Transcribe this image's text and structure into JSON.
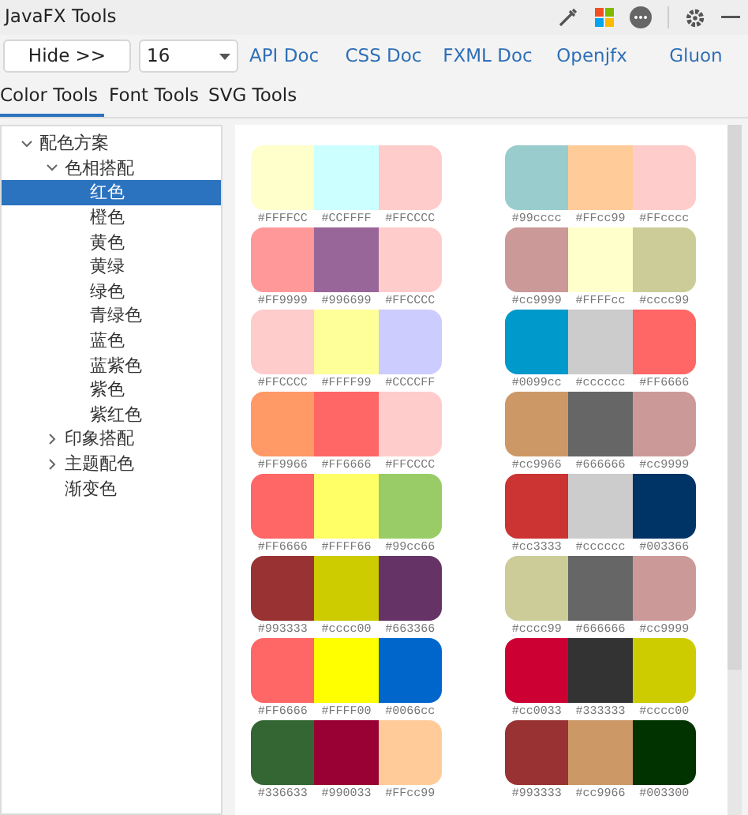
{
  "window": {
    "title": "JavaFX Tools"
  },
  "toolbar": {
    "hide_button": "Hide >>",
    "size_select": {
      "value": "16"
    },
    "links": [
      "API Doc",
      "CSS Doc",
      "FXML Doc",
      "Openjfx",
      "Gluon"
    ]
  },
  "tabs": [
    {
      "label": "Color Tools",
      "selected": true
    },
    {
      "label": "Font Tools",
      "selected": false
    },
    {
      "label": "SVG Tools",
      "selected": false
    }
  ],
  "tree": [
    {
      "label": "配色方案",
      "expanded": true,
      "selected": false,
      "children": [
        {
          "label": "色相搭配",
          "expanded": true,
          "selected": false,
          "children": [
            {
              "label": "红色",
              "selected": true
            },
            {
              "label": "橙色",
              "selected": false
            },
            {
              "label": "黄色",
              "selected": false
            },
            {
              "label": "黄绿",
              "selected": false
            },
            {
              "label": "绿色",
              "selected": false
            },
            {
              "label": "青绿色",
              "selected": false
            },
            {
              "label": "蓝色",
              "selected": false
            },
            {
              "label": "蓝紫色",
              "selected": false
            },
            {
              "label": "紫色",
              "selected": false
            },
            {
              "label": "紫红色",
              "selected": false
            }
          ]
        },
        {
          "label": "印象搭配",
          "expanded": false,
          "selected": false
        },
        {
          "label": "主题配色",
          "expanded": false,
          "selected": false
        },
        {
          "label": "渐变色",
          "selected": false
        }
      ]
    }
  ],
  "palettes": [
    {
      "swatches": [
        {
          "color": "#ffffcc",
          "label": "#FFFFCC"
        },
        {
          "color": "#ccffff",
          "label": "#CCFFFF"
        },
        {
          "color": "#ffcccc",
          "label": "#FFCCCC"
        }
      ]
    },
    {
      "swatches": [
        {
          "color": "#99cccc",
          "label": "#99cccc"
        },
        {
          "color": "#ffcc99",
          "label": "#FFcc99"
        },
        {
          "color": "#ffcccc",
          "label": "#FFcccc"
        }
      ]
    },
    {
      "swatches": [
        {
          "color": "#ff9999",
          "label": "#FF9999"
        },
        {
          "color": "#996699",
          "label": "#996699"
        },
        {
          "color": "#ffcccc",
          "label": "#FFCCCC"
        }
      ]
    },
    {
      "swatches": [
        {
          "color": "#cc9999",
          "label": "#cc9999"
        },
        {
          "color": "#ffffcc",
          "label": "#FFFFcc"
        },
        {
          "color": "#cccc99",
          "label": "#cccc99"
        }
      ]
    },
    {
      "swatches": [
        {
          "color": "#ffcccc",
          "label": "#FFCCCC"
        },
        {
          "color": "#ffff99",
          "label": "#FFFF99"
        },
        {
          "color": "#ccccff",
          "label": "#CCCCFF"
        }
      ]
    },
    {
      "swatches": [
        {
          "color": "#0099cc",
          "label": "#0099cc"
        },
        {
          "color": "#cccccc",
          "label": "#cccccc"
        },
        {
          "color": "#ff6666",
          "label": "#FF6666"
        }
      ]
    },
    {
      "swatches": [
        {
          "color": "#ff9966",
          "label": "#FF9966"
        },
        {
          "color": "#ff6666",
          "label": "#FF6666"
        },
        {
          "color": "#ffcccc",
          "label": "#FFCCCC"
        }
      ]
    },
    {
      "swatches": [
        {
          "color": "#cc9966",
          "label": "#cc9966"
        },
        {
          "color": "#666666",
          "label": "#666666"
        },
        {
          "color": "#cc9999",
          "label": "#cc9999"
        }
      ]
    },
    {
      "swatches": [
        {
          "color": "#ff6666",
          "label": "#FF6666"
        },
        {
          "color": "#ffff66",
          "label": "#FFFF66"
        },
        {
          "color": "#99cc66",
          "label": "#99cc66"
        }
      ]
    },
    {
      "swatches": [
        {
          "color": "#cc3333",
          "label": "#cc3333"
        },
        {
          "color": "#cccccc",
          "label": "#cccccc"
        },
        {
          "color": "#003366",
          "label": "#003366"
        }
      ]
    },
    {
      "swatches": [
        {
          "color": "#993333",
          "label": "#993333"
        },
        {
          "color": "#cccc00",
          "label": "#cccc00"
        },
        {
          "color": "#663366",
          "label": "#663366"
        }
      ]
    },
    {
      "swatches": [
        {
          "color": "#cccc99",
          "label": "#cccc99"
        },
        {
          "color": "#666666",
          "label": "#666666"
        },
        {
          "color": "#cc9999",
          "label": "#cc9999"
        }
      ]
    },
    {
      "swatches": [
        {
          "color": "#ff6666",
          "label": "#FF6666"
        },
        {
          "color": "#ffff00",
          "label": "#FFFF00"
        },
        {
          "color": "#0066cc",
          "label": "#0066cc"
        }
      ]
    },
    {
      "swatches": [
        {
          "color": "#cc0033",
          "label": "#cc0033"
        },
        {
          "color": "#333333",
          "label": "#333333"
        },
        {
          "color": "#cccc00",
          "label": "#cccc00"
        }
      ]
    },
    {
      "swatches": [
        {
          "color": "#336633",
          "label": "#336633"
        },
        {
          "color": "#990033",
          "label": "#990033"
        },
        {
          "color": "#ffcc99",
          "label": "#FFcc99"
        }
      ]
    },
    {
      "swatches": [
        {
          "color": "#993333",
          "label": "#993333"
        },
        {
          "color": "#cc9966",
          "label": "#cc9966"
        },
        {
          "color": "#003300",
          "label": "#003300"
        }
      ]
    }
  ]
}
